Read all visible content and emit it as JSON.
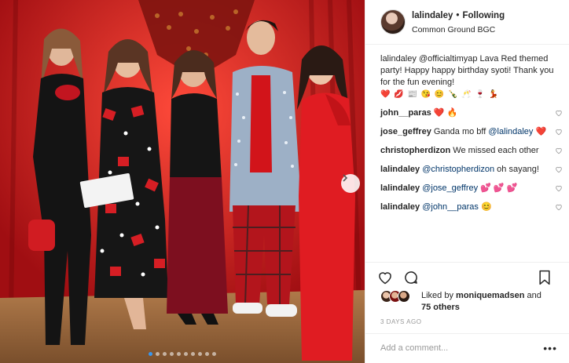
{
  "header": {
    "username": "lalindaley",
    "separator": "•",
    "follow_status": "Following",
    "location": "Common Ground BGC"
  },
  "caption": {
    "username": "lalindaley",
    "mention": "@officialtimyap",
    "text": "Lava Red themed party! Happy happy birthday syoti! Thank you for the fun evening!",
    "emojis": "❤️ 💋 📰 😘 😊 🍾 🥂 🍷 💃"
  },
  "comments": [
    {
      "username": "john__paras",
      "text": "❤️ 🔥"
    },
    {
      "username": "jose_geffrey",
      "text": "Ganda mo bff",
      "mention": "@lalindaley",
      "suffix": "❤️"
    },
    {
      "username": "christopherdizon",
      "text": "We missed each other"
    },
    {
      "username": "lalindaley",
      "mention": "@christopherdizon",
      "text": "oh sayang!"
    },
    {
      "username": "lalindaley",
      "mention": "@jose_geffrey",
      "text": "💕 💕 💕"
    },
    {
      "username": "lalindaley",
      "mention": "@john__paras",
      "text": "😊"
    }
  ],
  "likes": {
    "prefix": "Liked by",
    "username": "moniquemadsen",
    "joiner": "and",
    "others": "75 others"
  },
  "timestamp": "3 DAYS AGO",
  "add_comment": {
    "placeholder": "Add a comment..."
  },
  "more_label": "•••",
  "carousel": {
    "total_slides": 10,
    "active_index": 0
  },
  "icons": {
    "like": "heart-icon",
    "comment": "comment-icon",
    "save": "bookmark-icon",
    "next": "chevron-right-icon",
    "comment_like": "heart-icon"
  },
  "colors": {
    "accent_blue": "#3897f0",
    "mention": "#003569",
    "like_red": "#ed4956",
    "muted": "#999999",
    "photo_background": "#c4141a"
  }
}
